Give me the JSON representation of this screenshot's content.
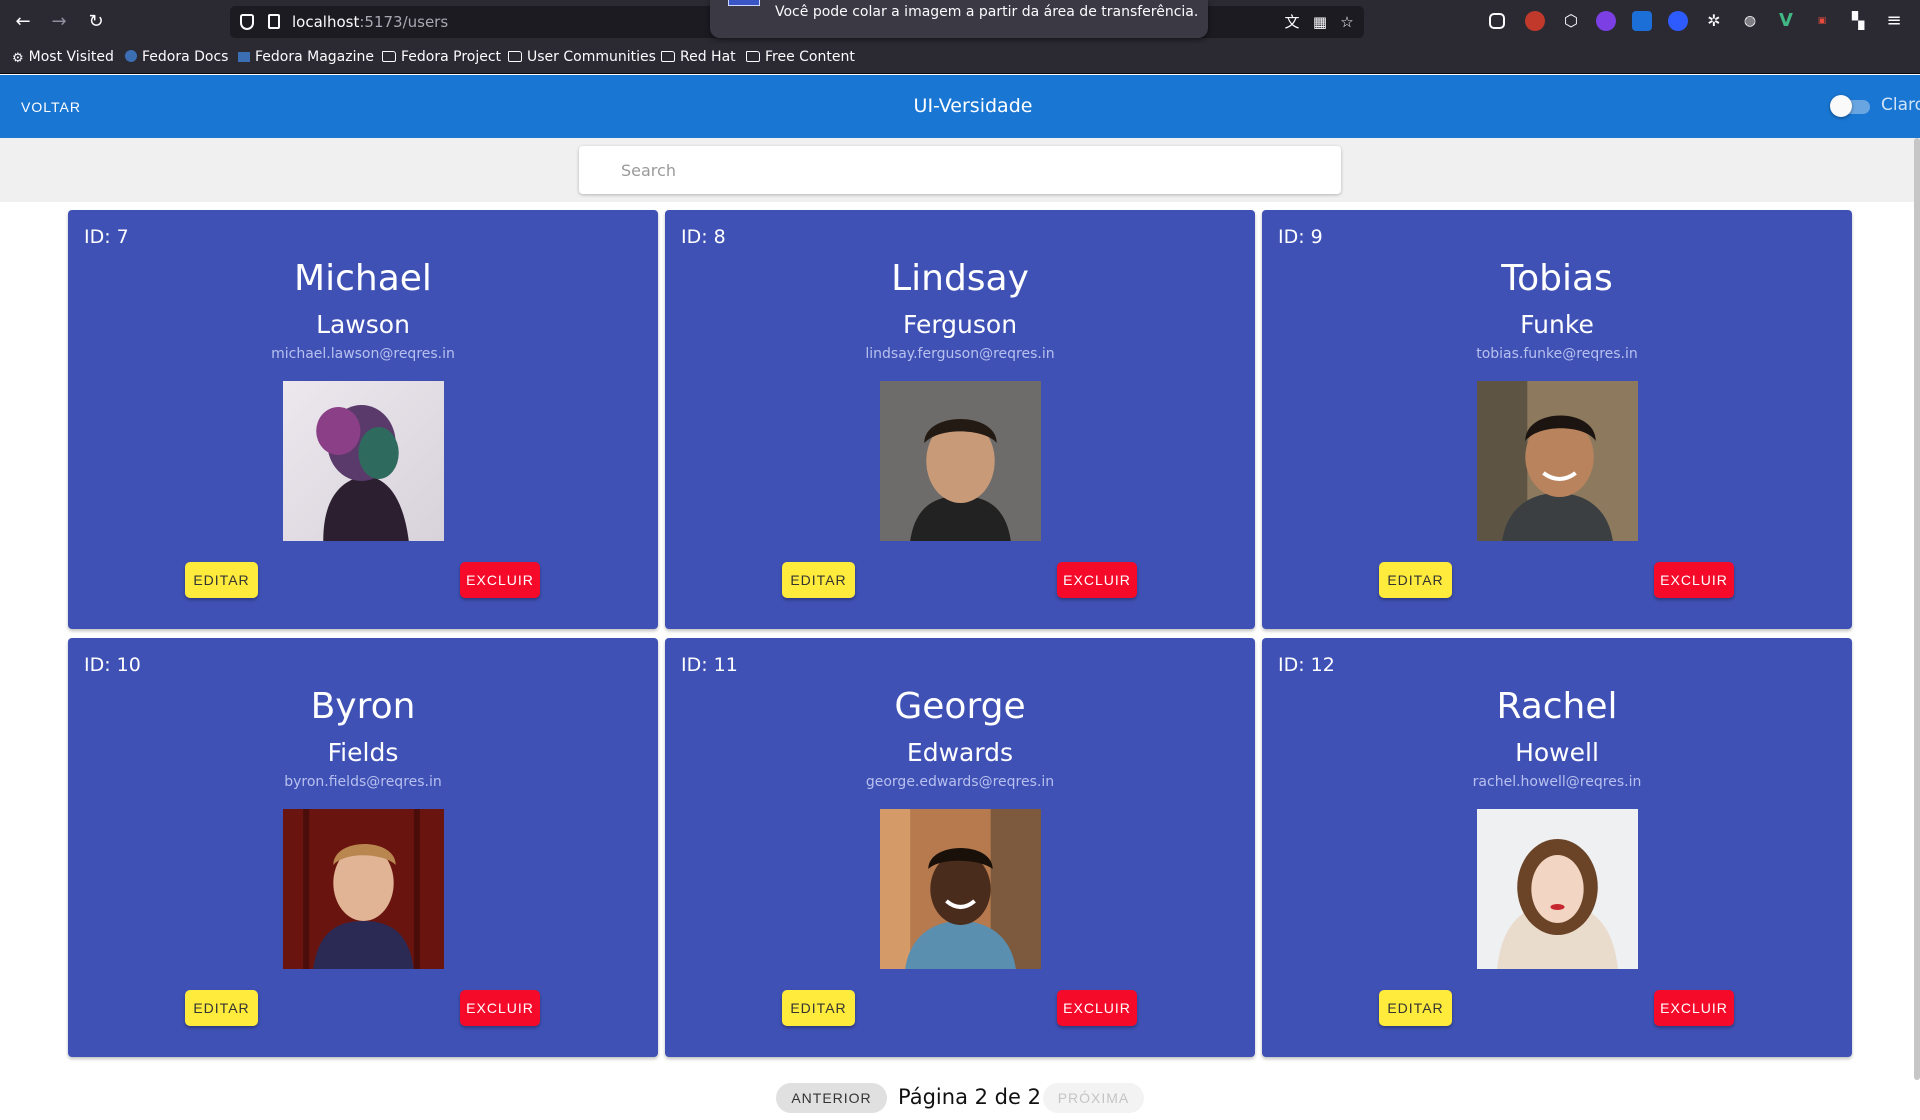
{
  "browser": {
    "url_host": "localhost",
    "url_rest": ":5173/users",
    "notification": "Você pode colar a imagem a partir da área de transferência.",
    "bookmarks": [
      "Most Visited",
      "Fedora Docs",
      "Fedora Magazine",
      "Fedora Project",
      "User Communities",
      "Red Hat",
      "Free Content"
    ]
  },
  "header": {
    "back_label": "VOLTAR",
    "title": "UI-Versidade",
    "theme_label": "Claro"
  },
  "search": {
    "placeholder": "Search"
  },
  "users": [
    {
      "id_label": "ID: 7",
      "first_name": "Michael",
      "last_name": "Lawson",
      "email": "michael.lawson@reqres.in"
    },
    {
      "id_label": "ID: 8",
      "first_name": "Lindsay",
      "last_name": "Ferguson",
      "email": "lindsay.ferguson@reqres.in"
    },
    {
      "id_label": "ID: 9",
      "first_name": "Tobias",
      "last_name": "Funke",
      "email": "tobias.funke@reqres.in"
    },
    {
      "id_label": "ID: 10",
      "first_name": "Byron",
      "last_name": "Fields",
      "email": "byron.fields@reqres.in"
    },
    {
      "id_label": "ID: 11",
      "first_name": "George",
      "last_name": "Edwards",
      "email": "george.edwards@reqres.in"
    },
    {
      "id_label": "ID: 12",
      "first_name": "Rachel",
      "last_name": "Howell",
      "email": "rachel.howell@reqres.in"
    }
  ],
  "card_actions": {
    "edit_label": "EDITAR",
    "delete_label": "EXCLUIR"
  },
  "pagination": {
    "prev_label": "ANTERIOR",
    "page_label": "Página 2 de 2",
    "next_label": "PRÓXIMA"
  },
  "colors": {
    "appbar": "#1976d2",
    "card": "#3f51b5",
    "edit": "#ffeb3b",
    "delete": "#f50a2a"
  }
}
